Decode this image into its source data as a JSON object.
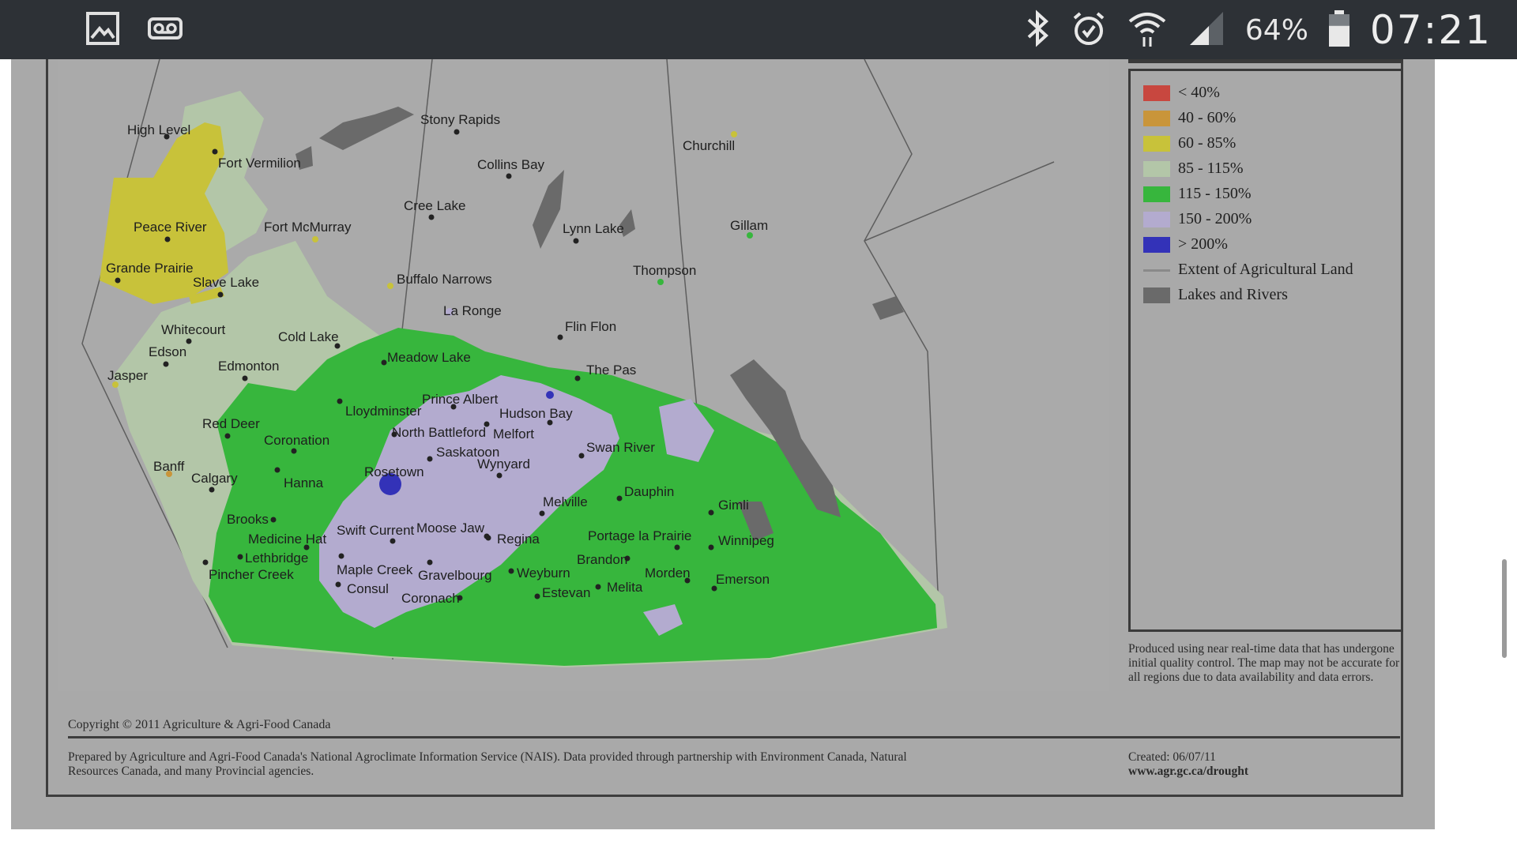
{
  "status_bar": {
    "left_icons": [
      "gallery-icon",
      "voicemail-icon"
    ],
    "right_icons": [
      "bluetooth-icon",
      "alarm-icon",
      "wifi-icon",
      "signal-icon",
      "battery-icon"
    ],
    "battery_percent": "64%",
    "battery_level": 0.64,
    "time": "07:21"
  },
  "map": {
    "places": [
      {
        "name": "High Level"
      },
      {
        "name": "Stony Rapids"
      },
      {
        "name": "Churchill"
      },
      {
        "name": "Fort Vermilion"
      },
      {
        "name": "Collins Bay"
      },
      {
        "name": "Cree Lake"
      },
      {
        "name": "Peace River"
      },
      {
        "name": "Fort McMurray"
      },
      {
        "name": "Lynn Lake"
      },
      {
        "name": "Gillam"
      },
      {
        "name": "Grande Prairie"
      },
      {
        "name": "Buffalo Narrows"
      },
      {
        "name": "Slave Lake"
      },
      {
        "name": "Thompson"
      },
      {
        "name": "La Ronge"
      },
      {
        "name": "Whitecourt"
      },
      {
        "name": "Cold Lake"
      },
      {
        "name": "Flin Flon"
      },
      {
        "name": "Edson"
      },
      {
        "name": "Edmonton"
      },
      {
        "name": "Meadow Lake"
      },
      {
        "name": "Jasper"
      },
      {
        "name": "The Pas"
      },
      {
        "name": "Prince Albert"
      },
      {
        "name": "Lloydminster"
      },
      {
        "name": "Hudson Bay"
      },
      {
        "name": "Red Deer"
      },
      {
        "name": "North Battleford"
      },
      {
        "name": "Melfort"
      },
      {
        "name": "Coronation"
      },
      {
        "name": "Saskatoon"
      },
      {
        "name": "Swan River"
      },
      {
        "name": "Wynyard"
      },
      {
        "name": "Banff"
      },
      {
        "name": "Rosetown"
      },
      {
        "name": "Calgary"
      },
      {
        "name": "Hanna"
      },
      {
        "name": "Dauphin"
      },
      {
        "name": "Melville"
      },
      {
        "name": "Gimli"
      },
      {
        "name": "Brooks"
      },
      {
        "name": "Swift Current"
      },
      {
        "name": "Moose Jaw"
      },
      {
        "name": "Medicine Hat"
      },
      {
        "name": "Regina"
      },
      {
        "name": "Portage la Prairie"
      },
      {
        "name": "Winnipeg"
      },
      {
        "name": "Lethbridge"
      },
      {
        "name": "Brandon"
      },
      {
        "name": "Maple Creek"
      },
      {
        "name": "Pincher Creek"
      },
      {
        "name": "Weyburn"
      },
      {
        "name": "Gravelbourg"
      },
      {
        "name": "Morden"
      },
      {
        "name": "Consul"
      },
      {
        "name": "Melita"
      },
      {
        "name": "Emerson"
      },
      {
        "name": "Estevan"
      },
      {
        "name": "Coronach"
      }
    ]
  },
  "legend": {
    "items": [
      {
        "label": "< 40%",
        "color": "#c8473f",
        "kind": "box"
      },
      {
        "label": "40 - 60%",
        "color": "#c9953a",
        "kind": "box"
      },
      {
        "label": "60 - 85%",
        "color": "#c8c23a",
        "kind": "box"
      },
      {
        "label": "85 - 115%",
        "color": "#b3c6a8",
        "kind": "box"
      },
      {
        "label": "115 - 150%",
        "color": "#37b63d",
        "kind": "box"
      },
      {
        "label": "150 - 200%",
        "color": "#b3abcf",
        "kind": "box"
      },
      {
        "label": "> 200%",
        "color": "#3332b8",
        "kind": "box"
      },
      {
        "label": "Extent of Agricultural Land",
        "color": "#8a8a8a",
        "kind": "line"
      },
      {
        "label": "Lakes and Rivers",
        "color": "#6a6a6a",
        "kind": "box"
      }
    ],
    "note": "Produced using near real-time data that has undergone initial quality control. The map may not be accurate for all regions due to data availability and data errors."
  },
  "footer": {
    "copyright": "Copyright © 2011 Agriculture & Agri-Food Canada",
    "prepared": "Prepared by Agriculture and Agri-Food Canada's National Agroclimate Information Service (NAIS). Data provided through partnership with Environment Canada, Natural Resources Canada, and many Provincial agencies.",
    "created": "Created: 06/07/11",
    "url": "www.agr.gc.ca/drought"
  }
}
